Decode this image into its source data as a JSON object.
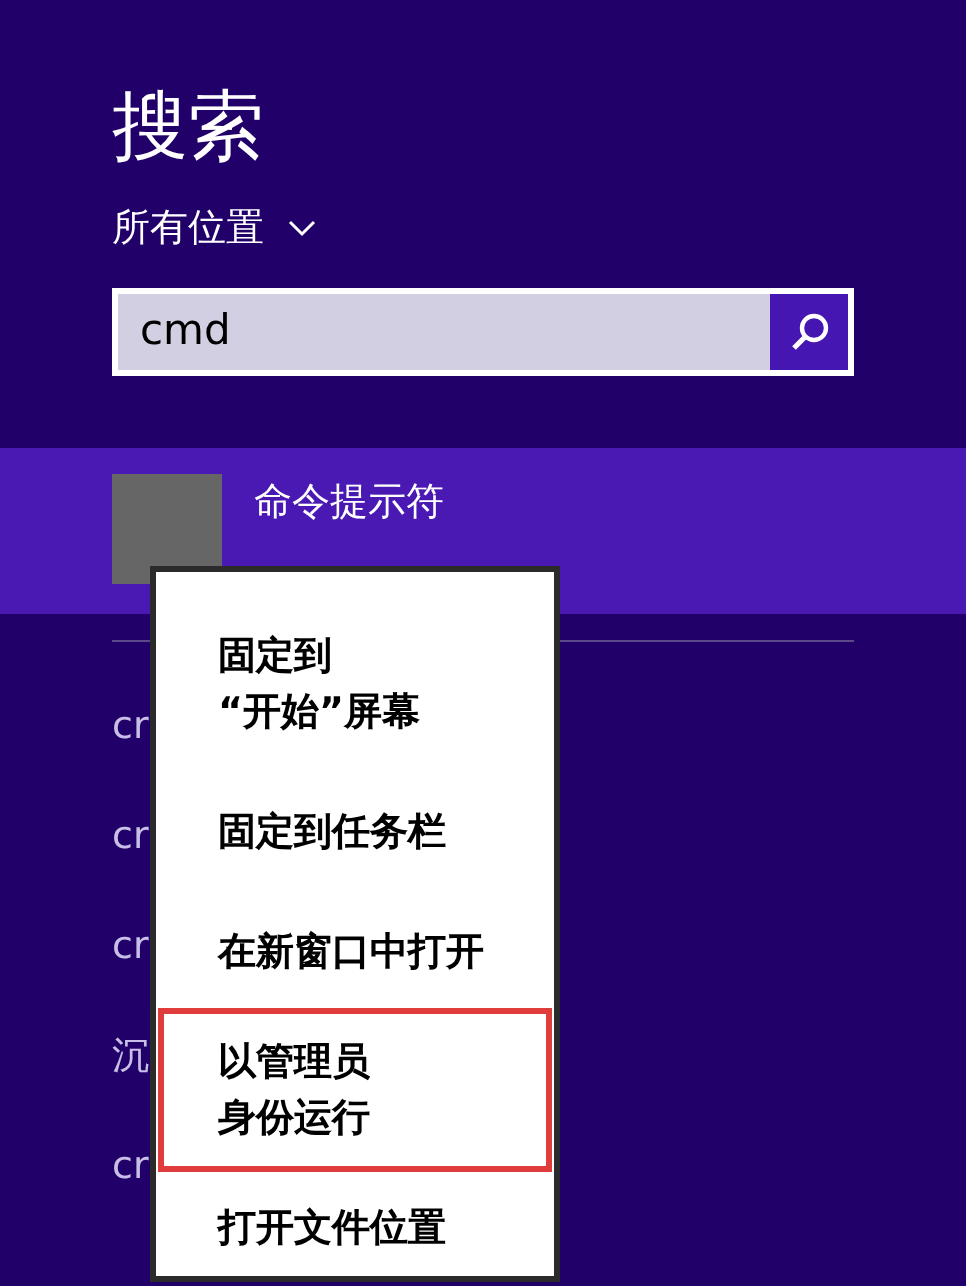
{
  "title": "搜索",
  "scope": {
    "label": "所有位置"
  },
  "search": {
    "value": "cmd"
  },
  "top_result": {
    "name": "命令提示符",
    "selected": true
  },
  "results": [
    {
      "name": "cr"
    },
    {
      "name": "cr"
    },
    {
      "name": "cr"
    },
    {
      "name": "沉"
    },
    {
      "name": "cr"
    }
  ],
  "context_menu": [
    {
      "lines": [
        "固定到",
        "“开始”屏幕"
      ],
      "highlighted": false
    },
    {
      "lines": [
        "固定到任务栏"
      ],
      "highlighted": false
    },
    {
      "lines": [
        "在新窗口中打开"
      ],
      "highlighted": false
    },
    {
      "lines": [
        "以管理员",
        "身份运行"
      ],
      "highlighted": true
    },
    {
      "lines": [
        "打开文件位置"
      ],
      "highlighted": false
    }
  ]
}
